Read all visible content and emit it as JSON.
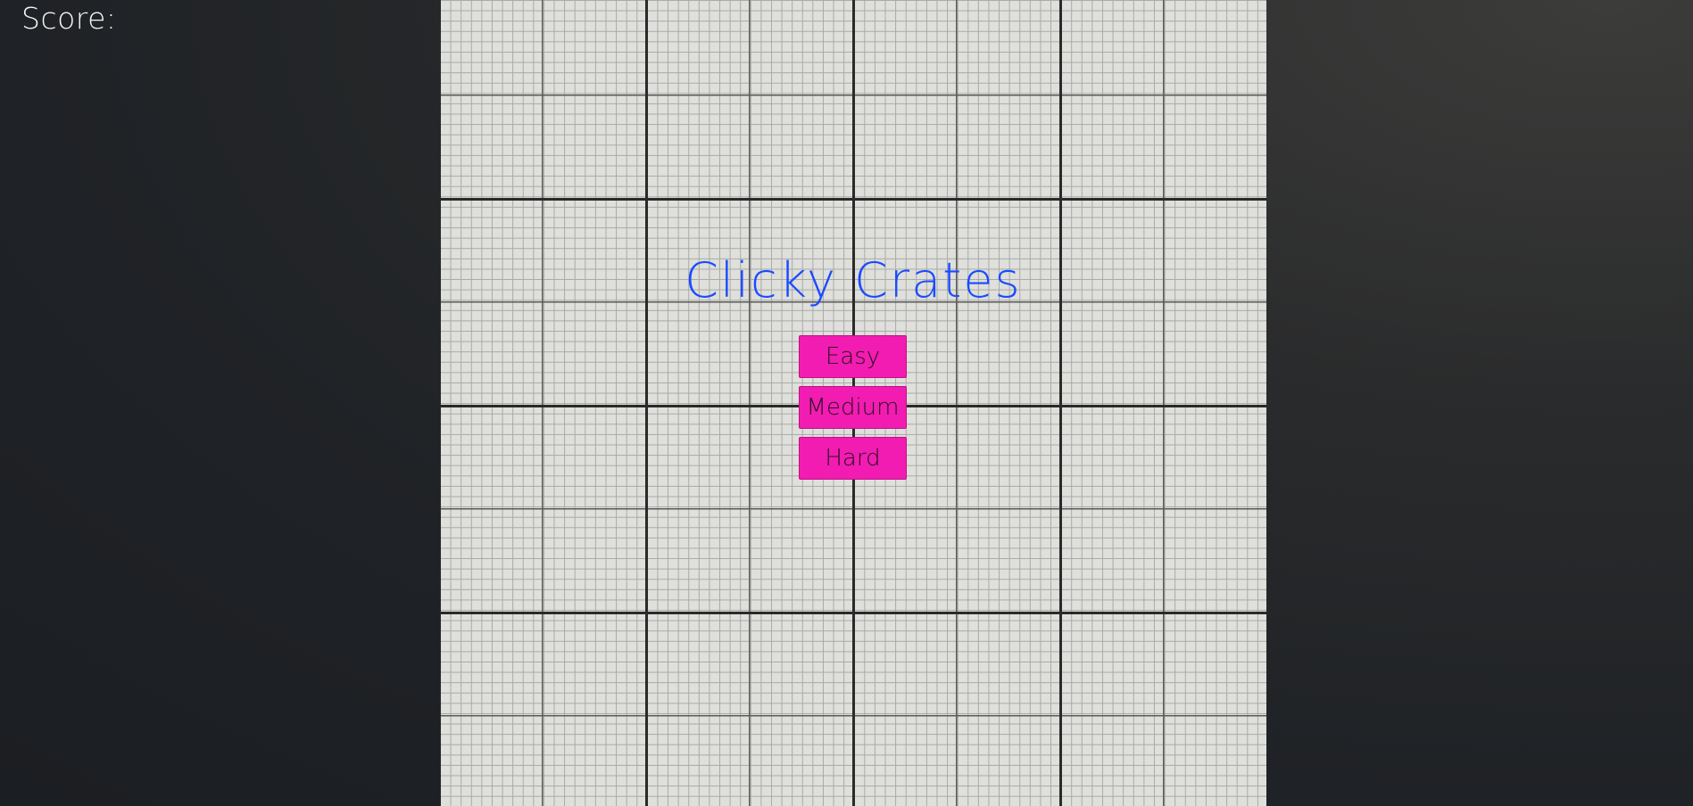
{
  "hud": {
    "score_label": "Score:"
  },
  "game": {
    "title": "Clicky Crates",
    "difficulty_buttons": [
      {
        "label": "Easy"
      },
      {
        "label": "Medium"
      },
      {
        "label": "Hard"
      }
    ]
  },
  "colors": {
    "title": "#1a4bff",
    "button": "#f21cb2",
    "board": "#dfdfdb",
    "background": "#1f2226"
  }
}
